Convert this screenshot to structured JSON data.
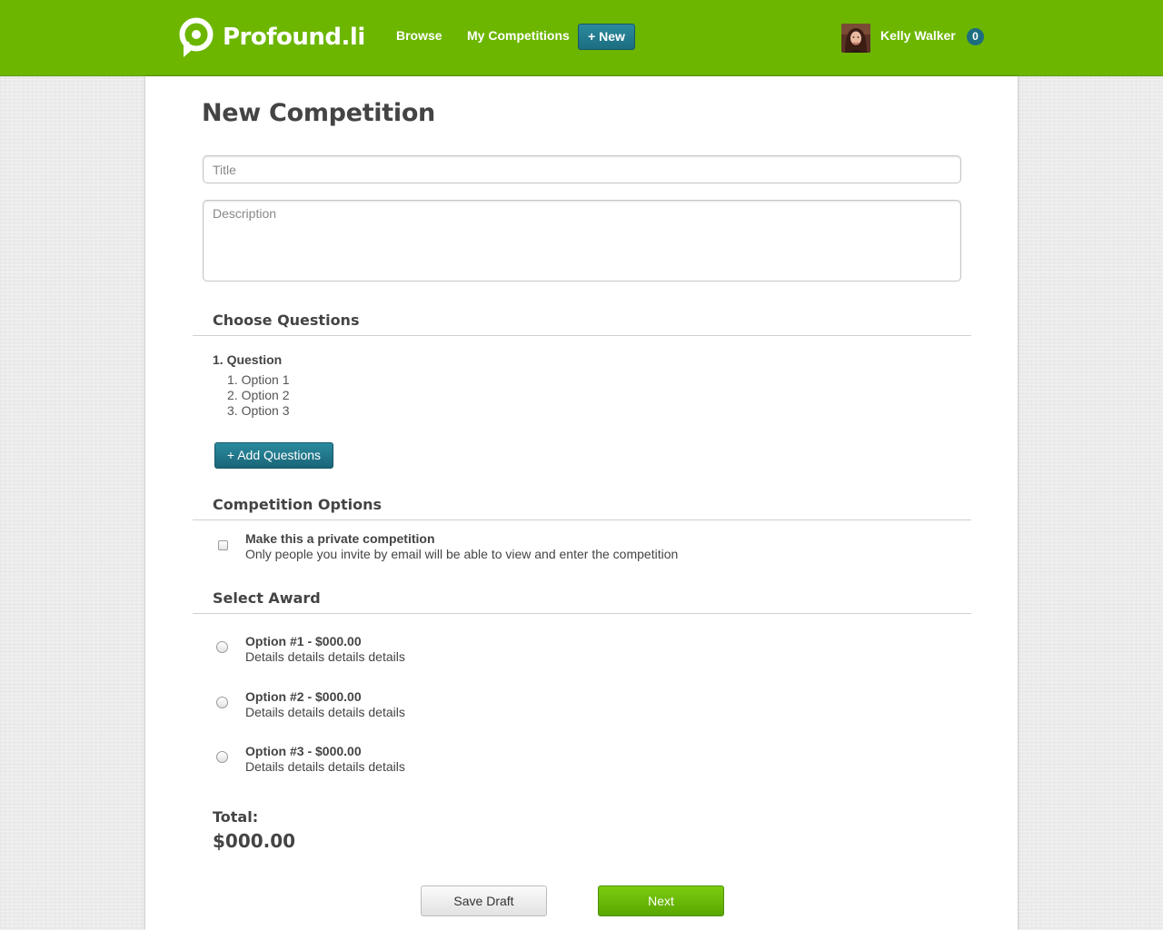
{
  "header": {
    "logo_text": "Profound.li",
    "nav": {
      "browse": "Browse",
      "my_competitions": "My Competitions",
      "new_button": "+ New"
    },
    "user": {
      "name": "Kelly Walker",
      "notification_count": "0"
    }
  },
  "main": {
    "page_title": "New Competition",
    "title_field": {
      "placeholder": "Title",
      "value": ""
    },
    "description_field": {
      "placeholder": "Description",
      "value": ""
    },
    "questions_section": {
      "heading": "Choose Questions",
      "question": {
        "label": "1. Question",
        "options": [
          "1. Option 1",
          "2. Option 2",
          "3. Option 3"
        ]
      },
      "add_button": "+ Add Questions"
    },
    "options_section": {
      "heading": "Competition Options",
      "private": {
        "checked": false,
        "label": "Make this a private competition",
        "description": "Only people you invite by email will be able to view and enter the competition"
      }
    },
    "award_section": {
      "heading": "Select Award",
      "options": [
        {
          "title": "Option #1 - $000.00",
          "details": "Details details details details",
          "selected": false
        },
        {
          "title": "Option #2 - $000.00",
          "details": "Details details details details",
          "selected": false
        },
        {
          "title": "Option #3 - $000.00",
          "details": "Details details details details",
          "selected": false
        }
      ]
    },
    "total": {
      "label": "Total:",
      "value": "$000.00"
    },
    "actions": {
      "save_draft": "Save Draft",
      "next": "Next"
    }
  },
  "colors": {
    "header_green": "#6cb600",
    "accent_teal": "#1d6d80",
    "next_green": "#6abb08"
  }
}
